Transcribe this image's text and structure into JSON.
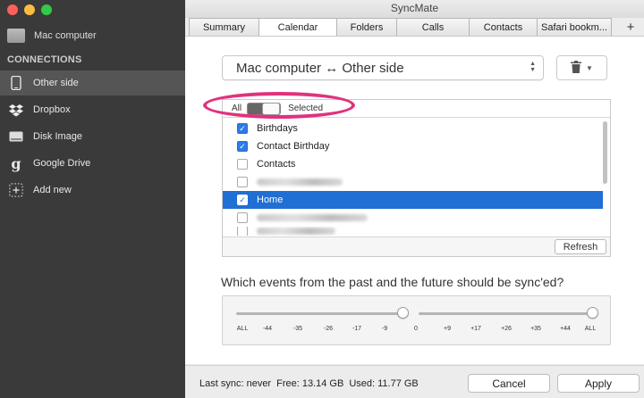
{
  "window": {
    "title": "SyncMate"
  },
  "sidebar": {
    "device": "Mac computer",
    "section_title": "CONNECTIONS",
    "items": [
      {
        "label": "Other side",
        "icon": "phone-icon",
        "active": true
      },
      {
        "label": "Dropbox",
        "icon": "dropbox-icon",
        "active": false
      },
      {
        "label": "Disk Image",
        "icon": "disk-image-icon",
        "active": false
      },
      {
        "label": "Google Drive",
        "icon": "google-drive-icon",
        "active": false
      },
      {
        "label": "Add new",
        "icon": "add-icon",
        "active": false
      }
    ]
  },
  "tabs": [
    "Summary",
    "Calendar",
    "Folders",
    "Calls",
    "Contacts",
    "Safari bookm..."
  ],
  "active_tab": "Calendar",
  "add_tab_label": "+",
  "sync_direction": "Mac computer ↔ Other side",
  "filter": {
    "all_label": "All",
    "selected_label": "Selected"
  },
  "calendars": [
    {
      "label": "Birthdays",
      "checked": true
    },
    {
      "label": "Contact Birthday",
      "checked": true
    },
    {
      "label": "Contacts",
      "checked": false
    },
    {
      "label": "",
      "checked": false,
      "blurred": true
    },
    {
      "label": "Home",
      "checked": true,
      "selected": true
    },
    {
      "label": "",
      "checked": false,
      "blurred": true
    },
    {
      "label": "",
      "checked": false,
      "blurred": true
    }
  ],
  "refresh_label": "Refresh",
  "question": "Which events from the past and the future should be sync'ed?",
  "slider": {
    "ticks": [
      "ALL",
      "-44",
      "-35",
      "-26",
      "-17",
      "-9",
      "0",
      "+9",
      "+17",
      "+26",
      "+35",
      "+44",
      "ALL"
    ],
    "past_value": "0",
    "future_value": "ALL"
  },
  "footer": {
    "last_sync": "Last sync: never",
    "free": "Free: 13.14 GB",
    "used": "Used: 11.77 GB",
    "cancel_label": "Cancel",
    "apply_label": "Apply"
  },
  "colors": {
    "accent": "#1f6fd4",
    "sidebar_bg": "#3a3a3a",
    "highlight": "#e0327d"
  }
}
